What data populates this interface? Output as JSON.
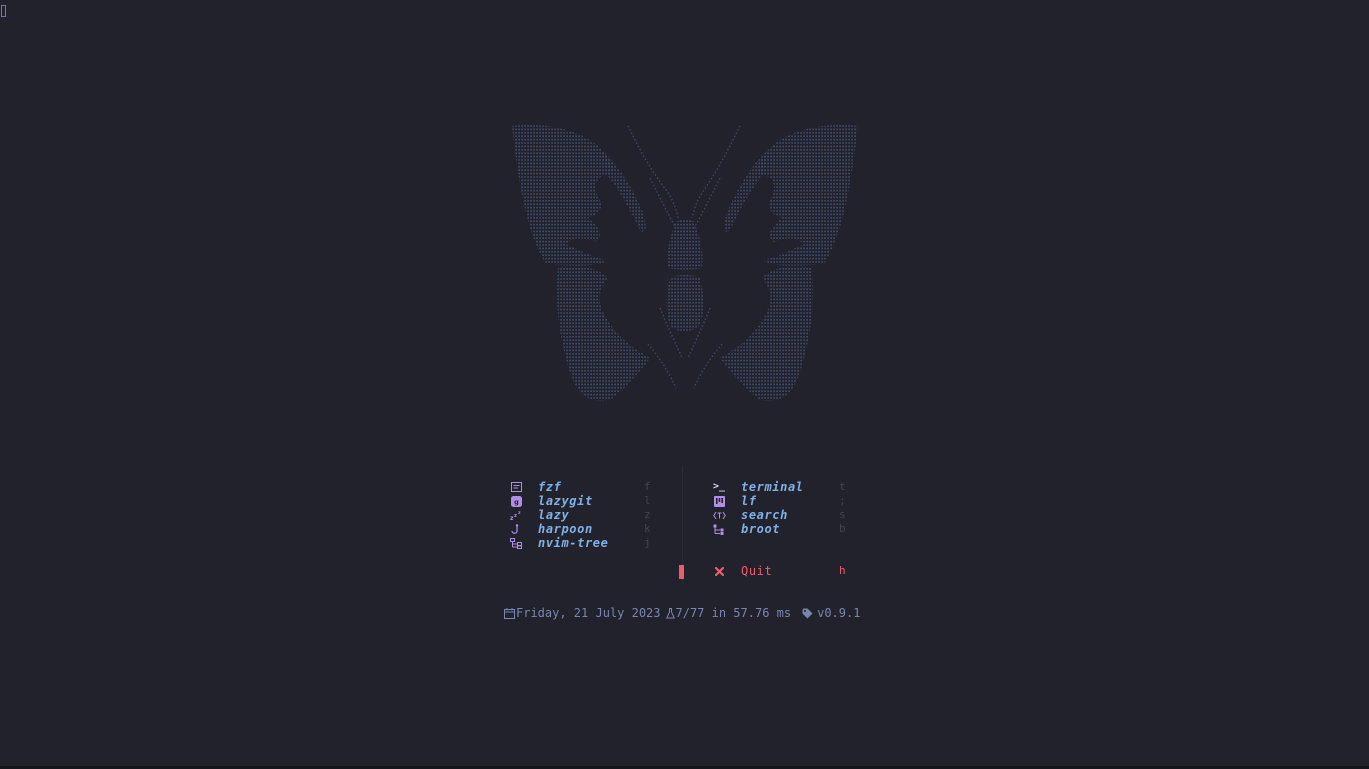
{
  "menu": {
    "left": [
      {
        "icon": "file-text-icon",
        "label": "fzf",
        "key": "f"
      },
      {
        "icon": "git-box-icon",
        "label": "lazygit",
        "key": "l"
      },
      {
        "icon": "sleep-zzz-icon",
        "label": "lazy",
        "key": "z"
      },
      {
        "icon": "hook-icon",
        "label": "harpoon",
        "key": "k"
      },
      {
        "icon": "file-tree-icon",
        "label": "nvim-tree",
        "key": "j"
      }
    ],
    "right": [
      {
        "icon": "terminal-prompt-icon",
        "label": "terminal",
        "key": "t"
      },
      {
        "icon": "kanban-icon",
        "label": "lf",
        "key": ";"
      },
      {
        "icon": "search-text-icon",
        "label": "search",
        "key": "s"
      },
      {
        "icon": "tree-branch-icon",
        "label": "broot",
        "key": "b"
      }
    ],
    "quit": {
      "icon": "close-x-icon",
      "label": "Quit",
      "key": "h"
    }
  },
  "footer": {
    "date": "Friday, 21 July 2023",
    "plugins": "7/77 in 57.76 ms",
    "version": "v0.9.1"
  },
  "colors": {
    "background": "#22222c",
    "label": "#7fb0e8",
    "icon": "#b08de8",
    "key": "#444450",
    "quit": "#ee5d6a",
    "footer": "#7b86b0",
    "art": "#3f4a6a"
  }
}
